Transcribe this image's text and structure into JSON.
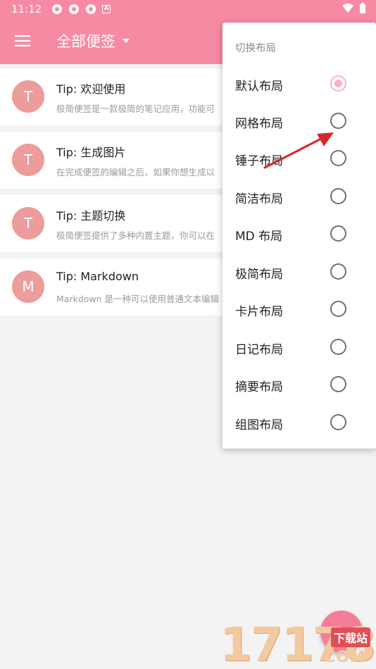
{
  "status_bar": {
    "time": "11:12",
    "icons": [
      "app-notification-icon",
      "app-notification-icon",
      "app-notification-icon",
      "a-icon"
    ],
    "right_icons": [
      "wifi-icon",
      "battery-icon"
    ]
  },
  "toolbar": {
    "title": "全部便签",
    "menu_icon": "menu-icon",
    "accent_color": "#f78aa3"
  },
  "notes": [
    {
      "avatar": "T",
      "title": "Tip: 欢迎使用",
      "preview": "极简便签是一款极简的笔记应用，功能可"
    },
    {
      "avatar": "T",
      "title": "Tip: 生成图片",
      "preview": "在完成便签的编辑之后，如果你想生成以"
    },
    {
      "avatar": "T",
      "title": "Tip: 主题切换",
      "preview": "极简便签提供了多种内置主题，你可以在"
    },
    {
      "avatar": "M",
      "title": "Tip: Markdown",
      "preview": "Markdown 是一种可以使用普通文本编辑"
    }
  ],
  "layout_menu": {
    "header": "切换布局",
    "items": [
      {
        "label": "默认布局",
        "checked": true
      },
      {
        "label": "网格布局",
        "checked": false
      },
      {
        "label": "锤子布局",
        "checked": false
      },
      {
        "label": "简洁布局",
        "checked": false
      },
      {
        "label": "MD 布局",
        "checked": false
      },
      {
        "label": "极简布局",
        "checked": false
      },
      {
        "label": "卡片布局",
        "checked": false
      },
      {
        "label": "日记布局",
        "checked": false
      },
      {
        "label": "摘要布局",
        "checked": false
      },
      {
        "label": "组图布局",
        "checked": false
      }
    ]
  },
  "watermark": {
    "number": "17178",
    "label": "下载站",
    "domain": "COM"
  }
}
